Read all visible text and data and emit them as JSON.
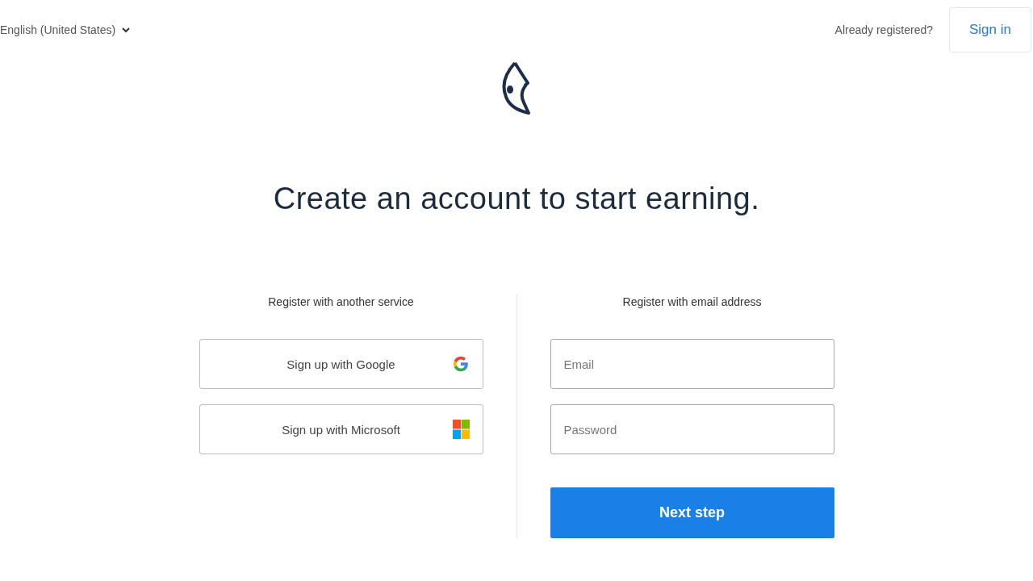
{
  "header": {
    "language": "English (United States)",
    "prompt": "Already registered?",
    "sign_in": "Sign in"
  },
  "heading": "Create an account to start earning.",
  "services": {
    "title": "Register with another service",
    "buttons": [
      {
        "label": "Sign up with Google",
        "kind": "google"
      },
      {
        "label": "Sign up with Microsoft",
        "kind": "microsoft"
      }
    ]
  },
  "email_form": {
    "title": "Register with email address",
    "fields": [
      {
        "placeholder": "Email"
      },
      {
        "placeholder": "Password"
      }
    ],
    "submit": "Next step"
  }
}
